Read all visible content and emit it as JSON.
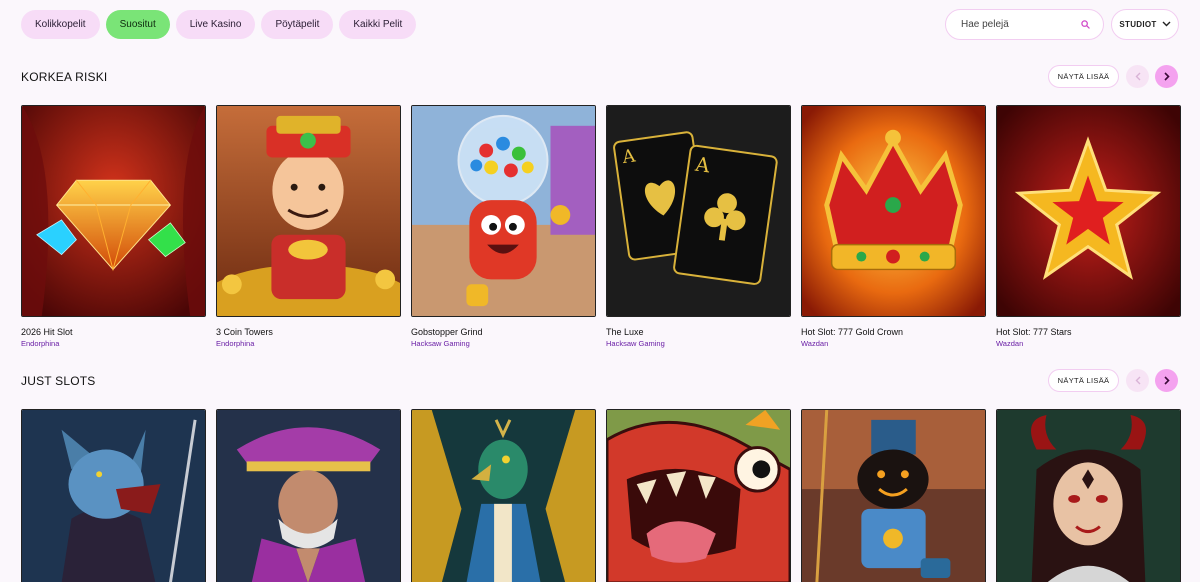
{
  "filters": {
    "tabs": [
      {
        "label": "Kolikkopelit"
      },
      {
        "label": "Suositut"
      },
      {
        "label": "Live Kasino"
      },
      {
        "label": "Pöytäpelit"
      },
      {
        "label": "Kaikki Pelit"
      }
    ],
    "active": "Suositut",
    "search_placeholder": "Hae pelejä",
    "studios_label": "STUDIOT"
  },
  "sections": [
    {
      "title": "KORKEA RISKI",
      "more_label": "NÄYTÄ LISÄÄ",
      "games": [
        {
          "title": "2026 Hit Slot",
          "studio": "Endorphina",
          "art": "diamond"
        },
        {
          "title": "3 Coin Towers",
          "studio": "Endorphina",
          "art": "god"
        },
        {
          "title": "Gobstopper Grind",
          "studio": "Hacksaw Gaming",
          "art": "gumball"
        },
        {
          "title": "The Luxe",
          "studio": "Hacksaw Gaming",
          "art": "aces"
        },
        {
          "title": "Hot Slot: 777 Gold Crown",
          "studio": "Wazdan",
          "art": "crown"
        },
        {
          "title": "Hot Slot: 777 Stars",
          "studio": "Wazdan",
          "art": "star"
        }
      ]
    },
    {
      "title": "JUST SLOTS",
      "more_label": "NÄYTÄ LISÄÄ",
      "games": [
        {
          "art": "wolf"
        },
        {
          "art": "pirate"
        },
        {
          "art": "peacock"
        },
        {
          "art": "monster"
        },
        {
          "art": "robot"
        },
        {
          "art": "demon"
        }
      ]
    }
  ],
  "colors": {
    "chip": "#f7dcf7",
    "chip_active": "#7ae477",
    "studio_text": "#6a1fa6",
    "nav_next": "#f4a2ef"
  }
}
